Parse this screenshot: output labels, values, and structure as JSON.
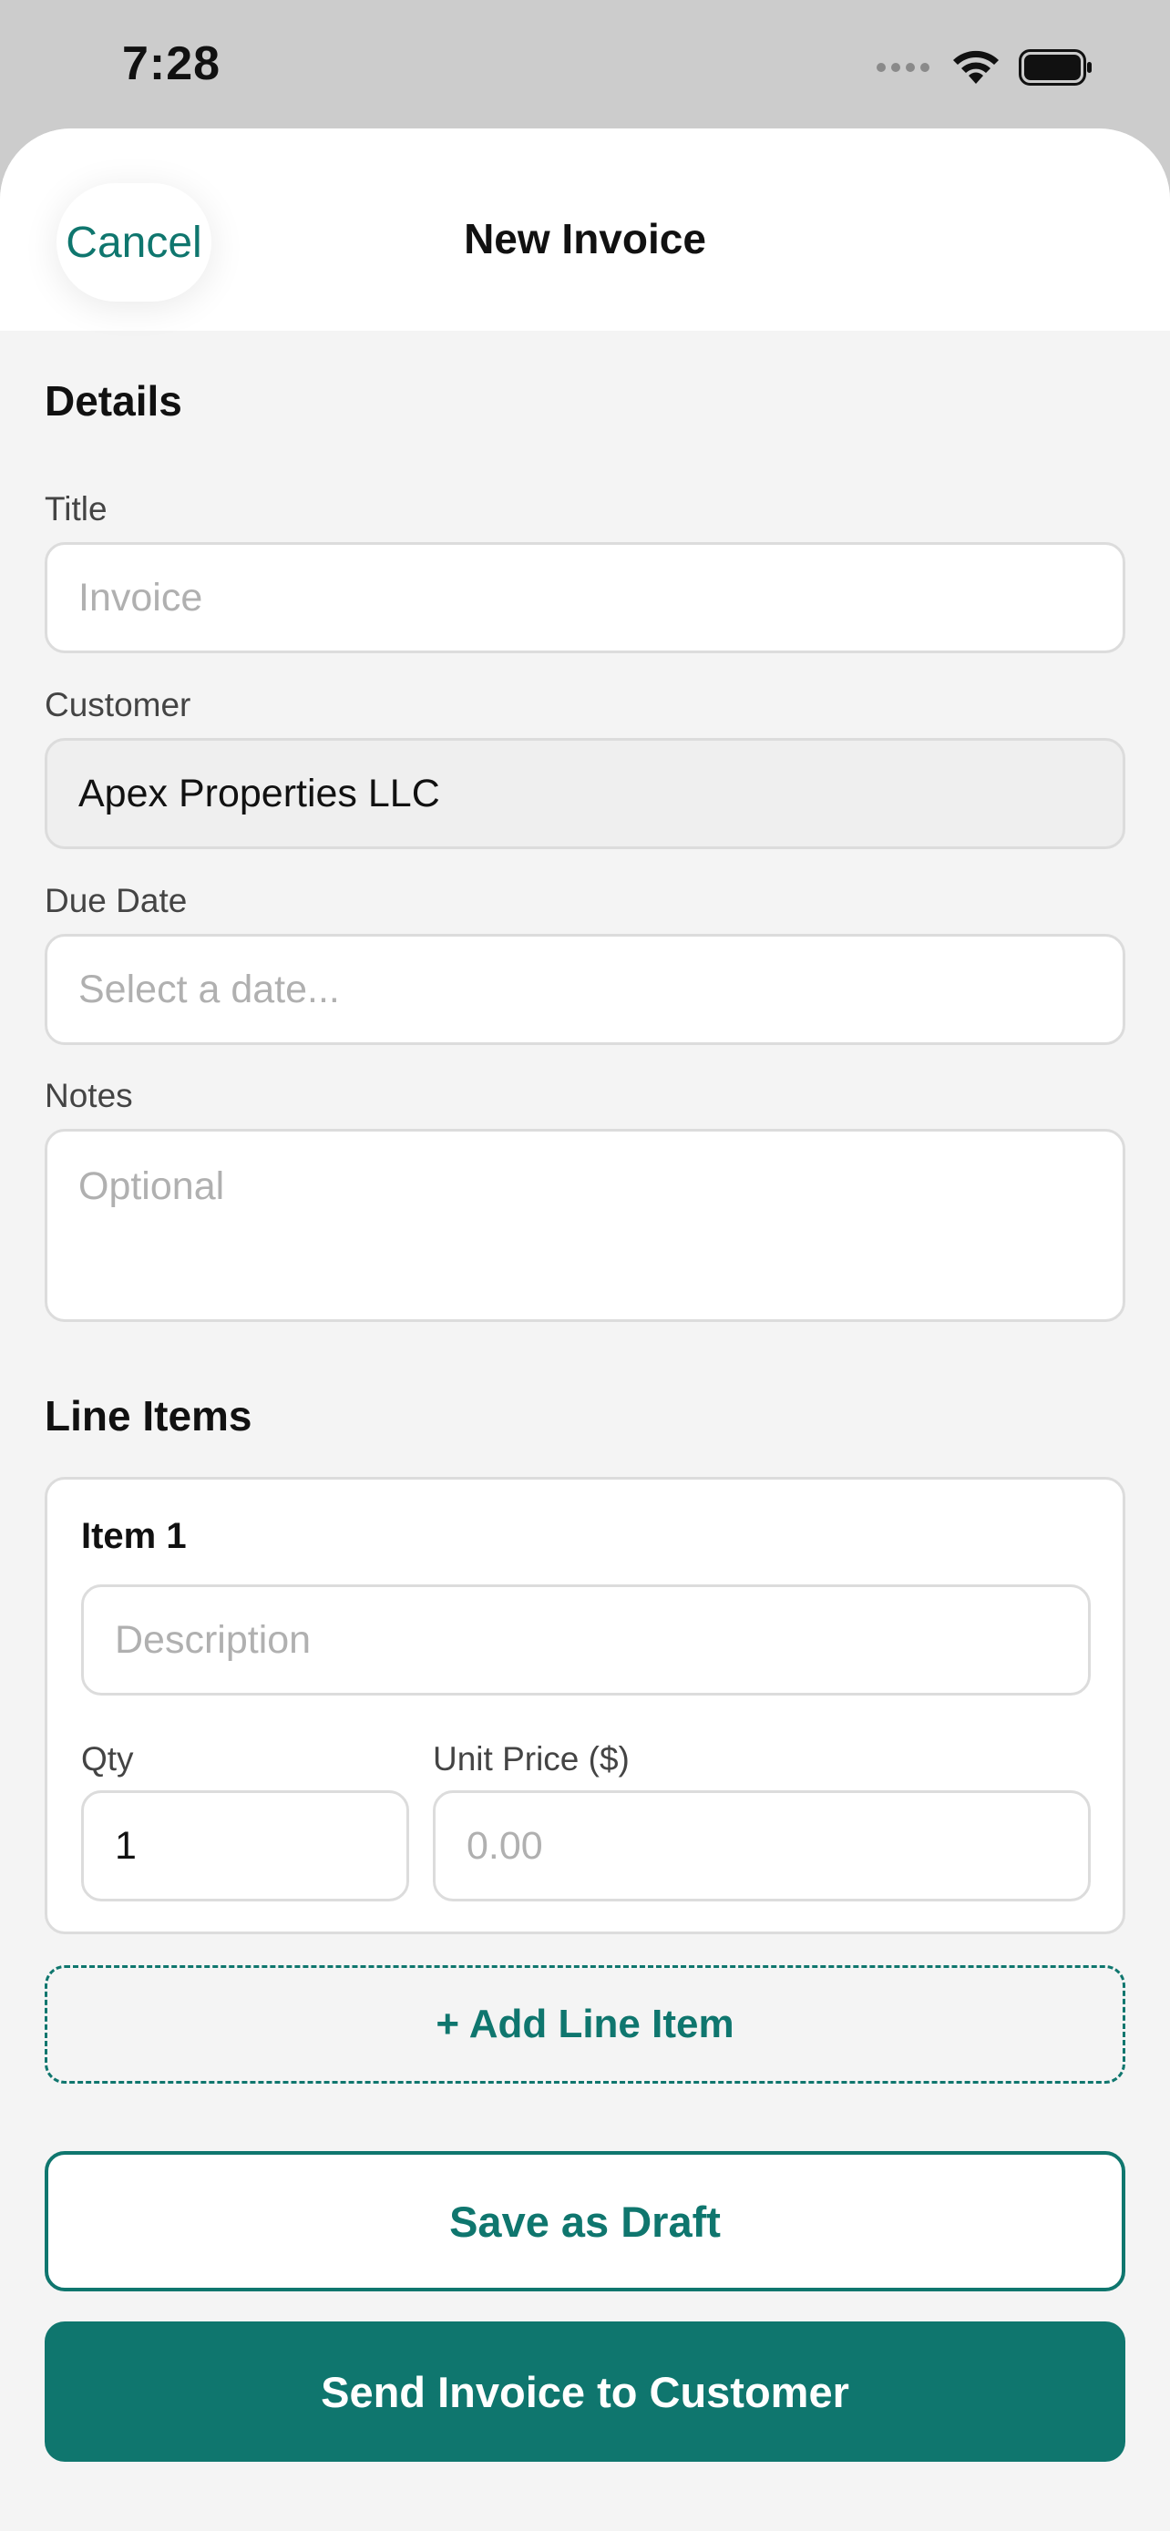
{
  "status_bar": {
    "time": "7:28",
    "icons": [
      "cellular-signal-icon",
      "wifi-icon",
      "battery-icon"
    ]
  },
  "nav": {
    "cancel_label": "Cancel",
    "title": "New Invoice"
  },
  "details": {
    "section_title": "Details",
    "title_label": "Title",
    "title_placeholder": "Invoice",
    "customer_label": "Customer",
    "customer_value": "Apex Properties LLC",
    "due_date_label": "Due Date",
    "due_date_placeholder": "Select a date...",
    "notes_label": "Notes",
    "notes_placeholder": "Optional"
  },
  "line_items": {
    "section_title": "Line Items",
    "items": [
      {
        "title": "Item 1",
        "description_placeholder": "Description",
        "qty_label": "Qty",
        "qty_value": "1",
        "unit_price_label": "Unit Price ($)",
        "unit_price_placeholder": "0.00"
      }
    ],
    "add_label": "+ Add Line Item"
  },
  "actions": {
    "save_draft_label": "Save as Draft",
    "send_label": "Send Invoice to Customer"
  },
  "colors": {
    "accent": "#0f766e",
    "background": "#f4f4f4",
    "status_bar": "#cccccc"
  }
}
